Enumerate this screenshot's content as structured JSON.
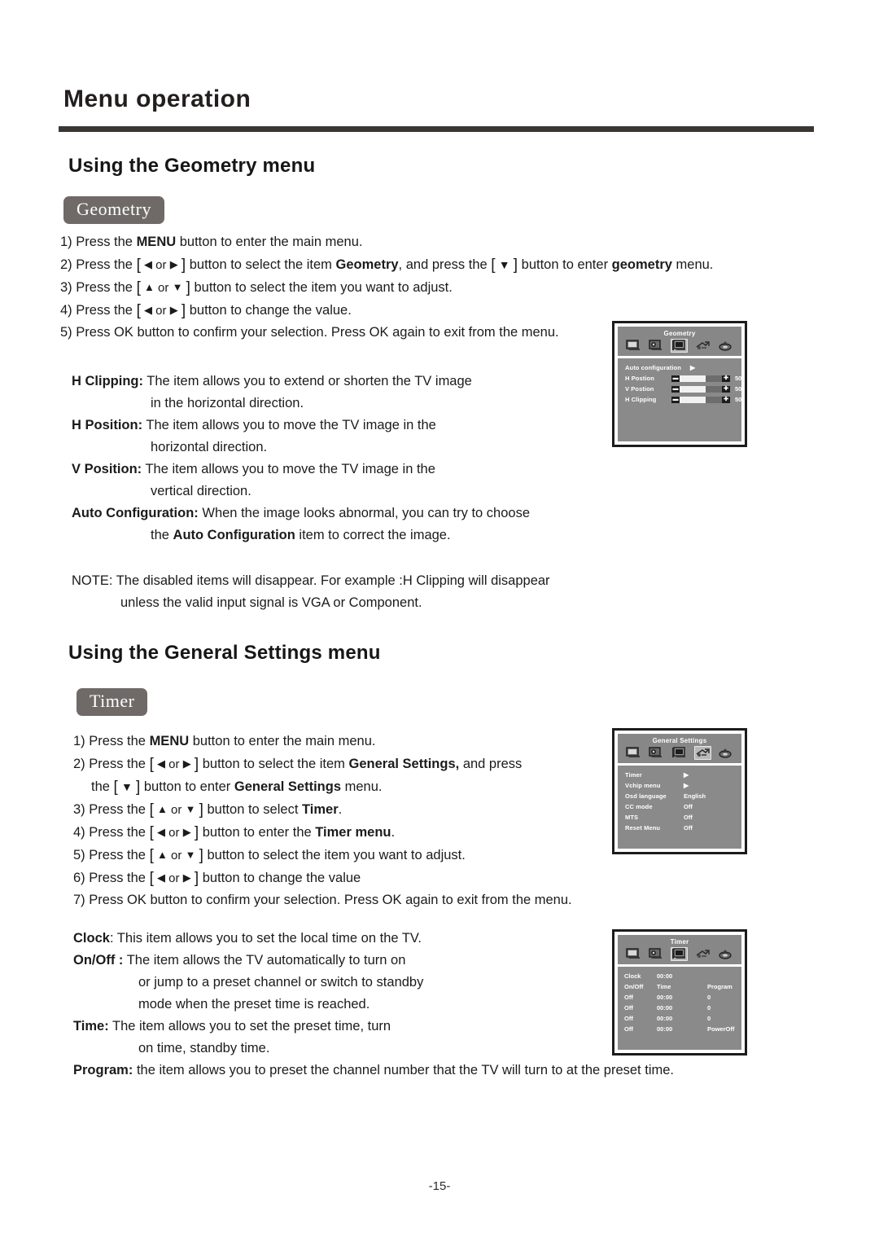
{
  "document": {
    "chapter_title": "Menu operation",
    "page_number": "-15-"
  },
  "geometry_section": {
    "heading": "Using the Geometry  menu",
    "badge": "Geometry",
    "steps": [
      {
        "num": "1)",
        "parts": [
          "Press the ",
          "MENU",
          " button to enter the main menu."
        ]
      },
      {
        "num": "2)",
        "text": "Press the [ ◀ or ▶ ] button to select the item Geometry, and press the [ ▼ ] button to enter geometry menu."
      },
      {
        "num": "3)",
        "text": "Press the [ ▲ or ▼ ] button to select the item you want to adjust."
      },
      {
        "num": "4)",
        "text": "Press the [ ◀ or ▶ ] button to change the value."
      },
      {
        "num": "5)",
        "text": "Press OK button to confirm your selection. Press OK again to exit from the menu."
      }
    ],
    "step1_pre": "Press the ",
    "step1_bold": "MENU",
    "step1_post": " button to enter the main menu.",
    "step2_a": "Press the ",
    "step2_b": " button to select the item ",
    "step2_bold1": "Geometry",
    "step2_c": ", and press the ",
    "step2_d": " button to enter ",
    "step2_bold2": "geometry",
    "step2_e": " menu.",
    "step3_a": "Press the ",
    "step3_b": " button to select the item you want to adjust.",
    "step4_a": "Press the ",
    "step4_b": " button to change the value.",
    "step5": "Press OK button to confirm your selection. Press OK again to exit from the menu.",
    "descriptions": [
      {
        "term": "H Clipping:",
        "line1": " The item allows you to extend or shorten the TV image",
        "line2": "in the horizontal direction."
      },
      {
        "term": "H Position:",
        "line1": " The item allows you to move the TV image in the",
        "line2": "horizontal direction."
      },
      {
        "term": "V Position:",
        "line1": " The item allows you to move the TV image in the",
        "line2": "vertical direction."
      },
      {
        "term": "Auto Configuration:",
        "line1": " When the image looks abnormal, you can try to choose",
        "line2_pre": "the ",
        "line2_bold": "Auto Configuration",
        "line2_post": " item to correct the image."
      }
    ],
    "note_line1": "NOTE: The disabled items will disappear. For example :H Clipping will disappear",
    "note_line2": "unless the valid input signal is VGA or Component."
  },
  "general_section": {
    "heading": "Using the General Settings  menu",
    "badge": "Timer",
    "step1_pre": "Press the ",
    "step1_bold": "MENU",
    "step1_post": " button to enter the main menu.",
    "step2_a": "Press the ",
    "step2_b": " button to select the item ",
    "step2_bold1": "General Settings,",
    "step2_c": " and press",
    "step2_line2_pre": "the ",
    "step2_line2_mid": " button to enter ",
    "step2_bold2": "General Settings",
    "step2_line2_post": " menu.",
    "step3_a": "Press the ",
    "step3_b": " button to select ",
    "step3_bold": "Timer",
    "step3_c": ".",
    "step4_a": "Press the ",
    "step4_b": " button to enter the ",
    "step4_bold": "Timer menu",
    "step4_c": ".",
    "step5_a": "Press the ",
    "step5_b": " button to select the item you want to adjust.",
    "step6_a": "Press the ",
    "step6_b": " button to change the value",
    "step7": "Press OK button to confirm your selection. Press OK again to exit from the menu.",
    "descriptions": {
      "clock_term": "Clock",
      "clock_text": ": This item allows you to set the local time on the TV.",
      "onoff_term": "On/Off :",
      "onoff_l1": " The item allows the TV automatically to turn on",
      "onoff_l2": "or jump to a preset channel or switch  to standby",
      "onoff_l3": "mode when the preset time is reached.",
      "time_term": "Time:",
      "time_l1": " The item allows you to set  the preset  time, turn",
      "time_l2": "on time, standby time.",
      "program_term": "Program:",
      "program_text": " the item allows you to preset the channel number that the TV will turn to at the preset time."
    }
  },
  "osd_geometry": {
    "title": "Geometry",
    "selected_icon_index": 2,
    "rows": [
      {
        "label": "Auto configuration",
        "type": "submenu",
        "value": "▶"
      },
      {
        "label": "H Postion",
        "type": "slider",
        "value": "50",
        "fill_pct": 62
      },
      {
        "label": "V Postion",
        "type": "slider",
        "value": "50",
        "fill_pct": 62
      },
      {
        "label": "H Clipping",
        "type": "slider",
        "value": "50",
        "fill_pct": 62
      }
    ]
  },
  "osd_general": {
    "title": "General Settings",
    "selected_icon_index": 3,
    "rows": [
      {
        "label": "Timer",
        "value": "▶",
        "type": "submenu"
      },
      {
        "label": "Vchip  menu",
        "value": "▶",
        "type": "submenu"
      },
      {
        "label": "Osd language",
        "value": "English",
        "type": "value"
      },
      {
        "label": "CC  mode",
        "value": "Off",
        "type": "value"
      },
      {
        "label": "MTS",
        "value": "Off",
        "type": "value"
      },
      {
        "label": "Reset Menu",
        "value": "Off",
        "type": "value"
      }
    ]
  },
  "osd_timer": {
    "title": "Timer",
    "selected_icon_index": 2,
    "clock_label": "Clock",
    "clock_value": "00:00",
    "headers": [
      "On/Off",
      "Time",
      "Program"
    ],
    "rows": [
      {
        "onoff": "Off",
        "time": "00:00",
        "program": "0"
      },
      {
        "onoff": "Off",
        "time": "00:00",
        "program": "0"
      },
      {
        "onoff": "Off",
        "time": "00:00",
        "program": "0"
      },
      {
        "onoff": "Off",
        "time": "00:00",
        "program": "PowerOff"
      }
    ]
  },
  "colors": {
    "rule": "#3a3733",
    "badge_bg": "#6f6a67",
    "osd_panel": "#8a8a8a",
    "osd_header": "#878787",
    "osd_border": "#1c1c1c",
    "osd_selected": "#b9b9b9"
  }
}
